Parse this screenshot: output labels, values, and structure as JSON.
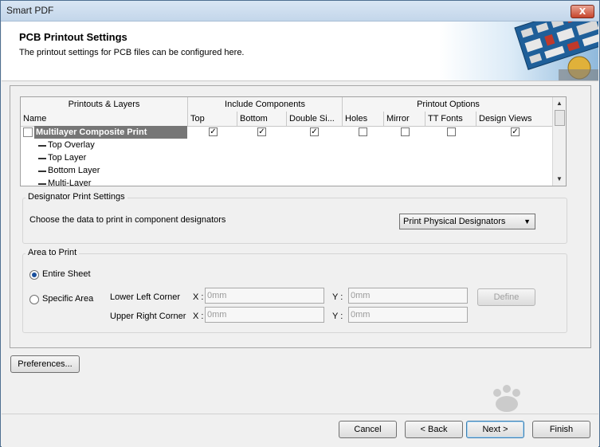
{
  "window": {
    "title": "Smart PDF",
    "close_glyph": "X"
  },
  "header": {
    "title": "PCB Printout Settings",
    "subtitle": "The printout settings for PCB files can be configured here."
  },
  "grid": {
    "group_headers": [
      "Printouts & Layers",
      "Include Components",
      "Printout Options"
    ],
    "columns": [
      "Name",
      "Top",
      "Bottom",
      "Double Si...",
      "Holes",
      "Mirror",
      "TT Fonts",
      "Design Views"
    ],
    "rows": [
      {
        "name": "Multilayer Composite Print",
        "checks": [
          true,
          true,
          true,
          false,
          false,
          false,
          true
        ],
        "selected": true
      },
      {
        "name": "Top Overlay"
      },
      {
        "name": "Top Layer"
      },
      {
        "name": "Bottom Layer"
      },
      {
        "name": "Multi-Layer"
      }
    ]
  },
  "designator": {
    "group_label": "Designator Print Settings",
    "label": "Choose the data to print in component designators",
    "selected": "Print Physical Designators"
  },
  "area": {
    "group_label": "Area to Print",
    "entire_sheet": "Entire Sheet",
    "specific_area": "Specific Area",
    "lower_left": "Lower Left Corner",
    "upper_right": "Upper Right Corner",
    "x_label": "X :",
    "y_label": "Y :",
    "placeholder": "0mm",
    "define": "Define"
  },
  "buttons": {
    "preferences": "Preferences...",
    "cancel": "Cancel",
    "back": "< Back",
    "next": "Next >",
    "finish": "Finish"
  },
  "colors": {
    "selection": "#767676",
    "radio_dot": "#1a4f9c",
    "close": "#c6452c"
  },
  "icons": {
    "close": "close-icon",
    "dropdown": "chevron-down-icon",
    "scroll_up": "scroll-up-icon",
    "scroll_down": "scroll-down-icon"
  }
}
